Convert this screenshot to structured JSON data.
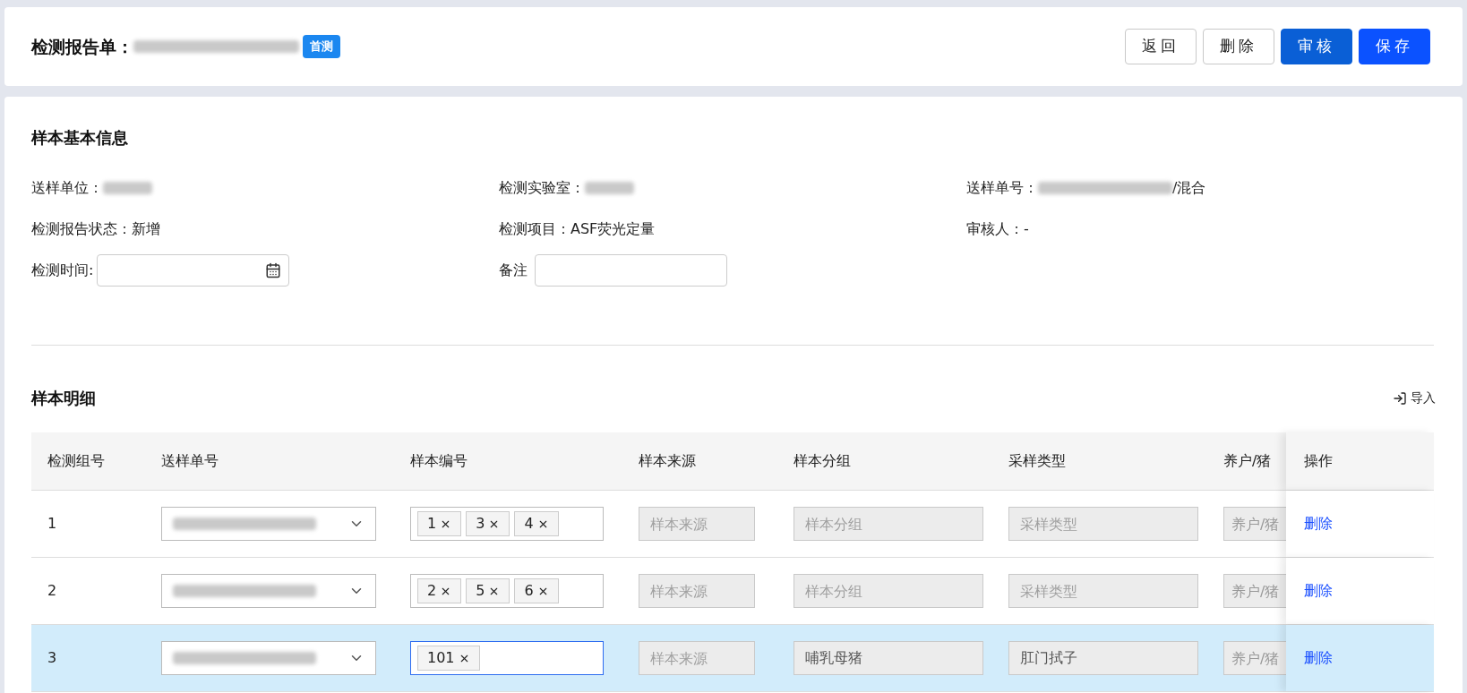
{
  "header": {
    "title": "检测报告单：",
    "badge": "首测",
    "buttons": [
      {
        "label": "返回",
        "kind": "default"
      },
      {
        "label": "删除",
        "kind": "default"
      },
      {
        "label": "审核",
        "kind": "review"
      },
      {
        "label": "保存",
        "kind": "primary"
      }
    ]
  },
  "basic_info": {
    "title": "样本基本信息",
    "fields": [
      {
        "label": "送样单位：",
        "kind": "redacted"
      },
      {
        "label": "检测实验室：",
        "kind": "redacted"
      },
      {
        "label": "送样单号：",
        "kind": "redacted",
        "suffix": "/混合"
      },
      {
        "label": "检测报告状态：",
        "kind": "text",
        "value": "新增"
      },
      {
        "label": "检测项目：",
        "kind": "text",
        "value": "ASF荧光定量"
      },
      {
        "kind": "plain",
        "text": "审核人：-"
      },
      {
        "label": "检测时间:",
        "kind": "date"
      },
      {
        "label": "备注",
        "kind": "input"
      }
    ]
  },
  "detail": {
    "title": "样本明细",
    "import_button": "导入",
    "columns": [
      "检测组号",
      "送样单号",
      "样本编号",
      "样本来源",
      "样本分组",
      "采样类型",
      "养户/猪",
      "操作"
    ],
    "rows": [
      {
        "group": "1",
        "selected": false,
        "tags": [
          "1",
          "3",
          "4"
        ],
        "tags_focused": false,
        "source": {
          "placeholder": "样本来源"
        },
        "sample_group": {
          "placeholder": "样本分组"
        },
        "sampling_type": {
          "placeholder": "采样类型"
        },
        "farm": {
          "placeholder": "养户/猪"
        },
        "action": "删除"
      },
      {
        "group": "2",
        "selected": false,
        "tags": [
          "2",
          "5",
          "6"
        ],
        "tags_focused": false,
        "source": {
          "placeholder": "样本来源"
        },
        "sample_group": {
          "placeholder": "样本分组"
        },
        "sampling_type": {
          "placeholder": "采样类型"
        },
        "farm": {
          "placeholder": "养户/猪"
        },
        "action": "删除"
      },
      {
        "group": "3",
        "selected": true,
        "tags": [
          "101"
        ],
        "tags_focused": true,
        "source": {
          "placeholder": "样本来源"
        },
        "sample_group": {
          "value": "哺乳母猪"
        },
        "sampling_type": {
          "value": "肛门拭子"
        },
        "farm": {
          "placeholder": "养户/猪"
        },
        "action": "删除"
      }
    ]
  }
}
